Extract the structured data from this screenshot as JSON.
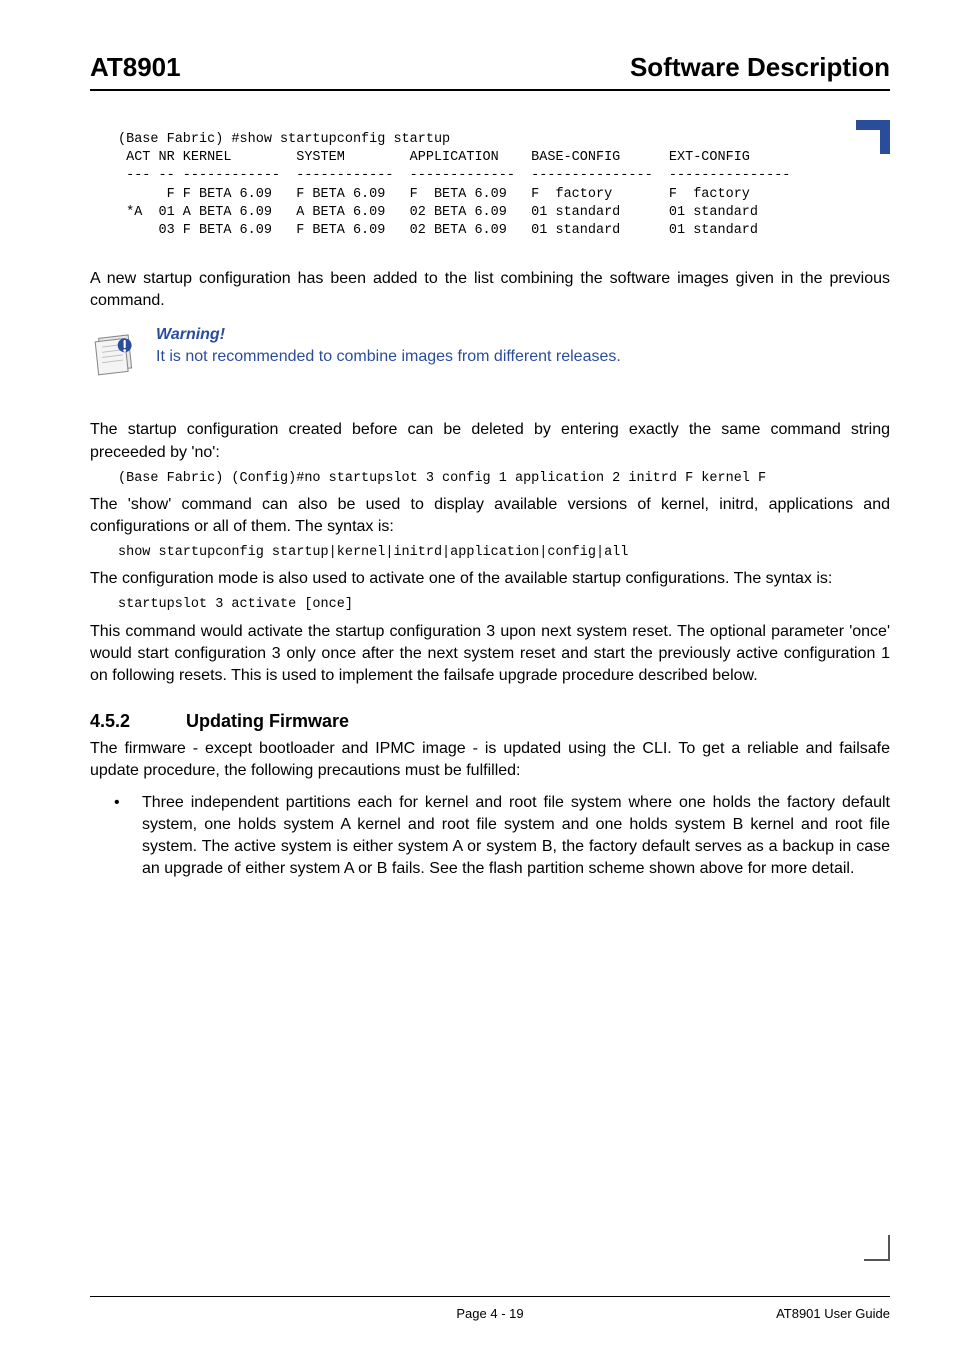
{
  "header": {
    "left": "AT8901",
    "right": "Software Description"
  },
  "code_block_1": "(Base Fabric) #show startupconfig startup\n ACT NR KERNEL        SYSTEM        APPLICATION    BASE-CONFIG      EXT-CONFIG\n --- -- ------------  ------------  -------------  ---------------  ---------------\n      F F BETA 6.09   F BETA 6.09   F  BETA 6.09   F  factory       F  factory\n *A  01 A BETA 6.09   A BETA 6.09   02 BETA 6.09   01 standard      01 standard\n     03 F BETA 6.09   F BETA 6.09   02 BETA 6.09   01 standard      01 standard",
  "para_1": "A new startup configuration has been added to the list combining the software images given in the previous command.",
  "warning": {
    "title": "Warning!",
    "text": "It is not recommended to combine images from different releases."
  },
  "para_2": "The startup configuration created before can be deleted by entering exactly the same command string preceeded by 'no':",
  "code_line_1": "(Base Fabric) (Config)#no startupslot 3 config 1 application 2 initrd F kernel F",
  "para_3": "The 'show' command can also be used to display available versions of kernel, initrd, applications and configurations or all of them. The syntax is:",
  "code_line_2": "show startupconfig startup|kernel|initrd|application|config|all",
  "para_4": "The configuration mode is also used to activate one of the available startup configurations. The syntax is:",
  "code_line_3": "startupslot 3 activate [once]",
  "para_5": "This command would activate the startup configuration 3 upon next system reset. The optional parameter 'once' would start configuration 3 only once after the next system reset and start the previously active configuration 1 on following resets. This is used to implement the failsafe upgrade procedure described below.",
  "section": {
    "number": "4.5.2",
    "title": "Updating Firmware"
  },
  "para_6": "The firmware - except bootloader and IPMC image - is updated using the CLI. To get a reliable and failsafe update procedure, the following precautions must be fulfilled:",
  "bullet_1": "Three independent partitions each for kernel and root file system where one holds the factory default system, one holds system A kernel and root file system and one holds system B kernel and root file system. The active system is either system A or system B, the factory default serves as a backup in case an upgrade of either system A or B fails. See the flash partition scheme shown above for more detail.",
  "footer": {
    "center": "Page 4 - 19",
    "right": "AT8901 User Guide"
  }
}
